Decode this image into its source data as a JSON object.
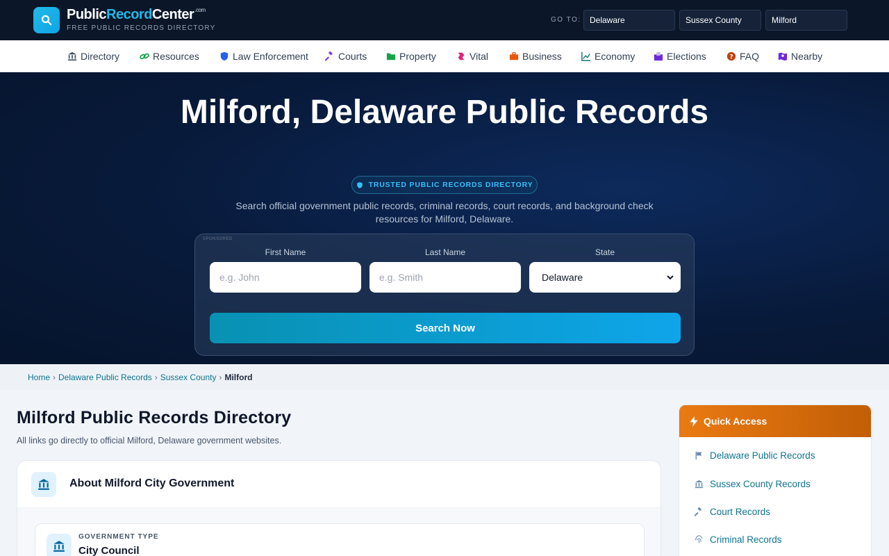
{
  "brand": {
    "name_part1": "Public",
    "name_part2": "Record",
    "name_part3": "Center",
    "name_suffix": ".com",
    "tagline": "FREE PUBLIC RECORDS DIRECTORY"
  },
  "goto": {
    "label": "GO TO:",
    "state": "Delaware",
    "county": "Sussex County",
    "city": "Milford"
  },
  "nav": {
    "items": [
      {
        "label": "Directory",
        "icon": "bank-icon"
      },
      {
        "label": "Resources",
        "icon": "link-icon"
      },
      {
        "label": "Law Enforcement",
        "icon": "shield-icon"
      },
      {
        "label": "Courts",
        "icon": "gavel-icon"
      },
      {
        "label": "Property",
        "icon": "folder-icon"
      },
      {
        "label": "Vital",
        "icon": "ribbon-icon"
      },
      {
        "label": "Business",
        "icon": "briefcase-icon"
      },
      {
        "label": "Economy",
        "icon": "chart-icon"
      },
      {
        "label": "Elections",
        "icon": "vote-icon"
      },
      {
        "label": "FAQ",
        "icon": "question-icon"
      },
      {
        "label": "Nearby",
        "icon": "map-icon"
      }
    ]
  },
  "hero": {
    "title": "Milford, Delaware Public Records",
    "badge": "TRUSTED PUBLIC RECORDS DIRECTORY",
    "subtitle": "Search official government public records, criminal records, court records, and background check resources for Milford, Delaware."
  },
  "search": {
    "sponsored": "SPONSORED",
    "first_name_label": "First Name",
    "first_name_placeholder": "e.g. John",
    "last_name_label": "Last Name",
    "last_name_placeholder": "e.g. Smith",
    "state_label": "State",
    "state_value": "Delaware",
    "button": "Search Now"
  },
  "breadcrumb": {
    "home": "Home",
    "state": "Delaware Public Records",
    "county": "Sussex County",
    "current": "Milford",
    "separator": "›"
  },
  "main": {
    "title": "Milford Public Records Directory",
    "description": "All links go directly to official Milford, Delaware government websites.",
    "about_title": "About Milford City Government",
    "gov_type_label": "GOVERNMENT TYPE",
    "gov_type_value": "City Council"
  },
  "sidebar": {
    "title": "Quick Access",
    "items": [
      {
        "label": "Delaware Public Records",
        "icon": "flag-icon"
      },
      {
        "label": "Sussex County Records",
        "icon": "bank-icon"
      },
      {
        "label": "Court Records",
        "icon": "gavel-icon"
      },
      {
        "label": "Criminal Records",
        "icon": "fingerprint-icon"
      }
    ]
  },
  "colors": {
    "accent": "#22b8e6",
    "topbar": "#0b1628",
    "quick_access": "#ea7a12",
    "link": "#0e7490"
  }
}
